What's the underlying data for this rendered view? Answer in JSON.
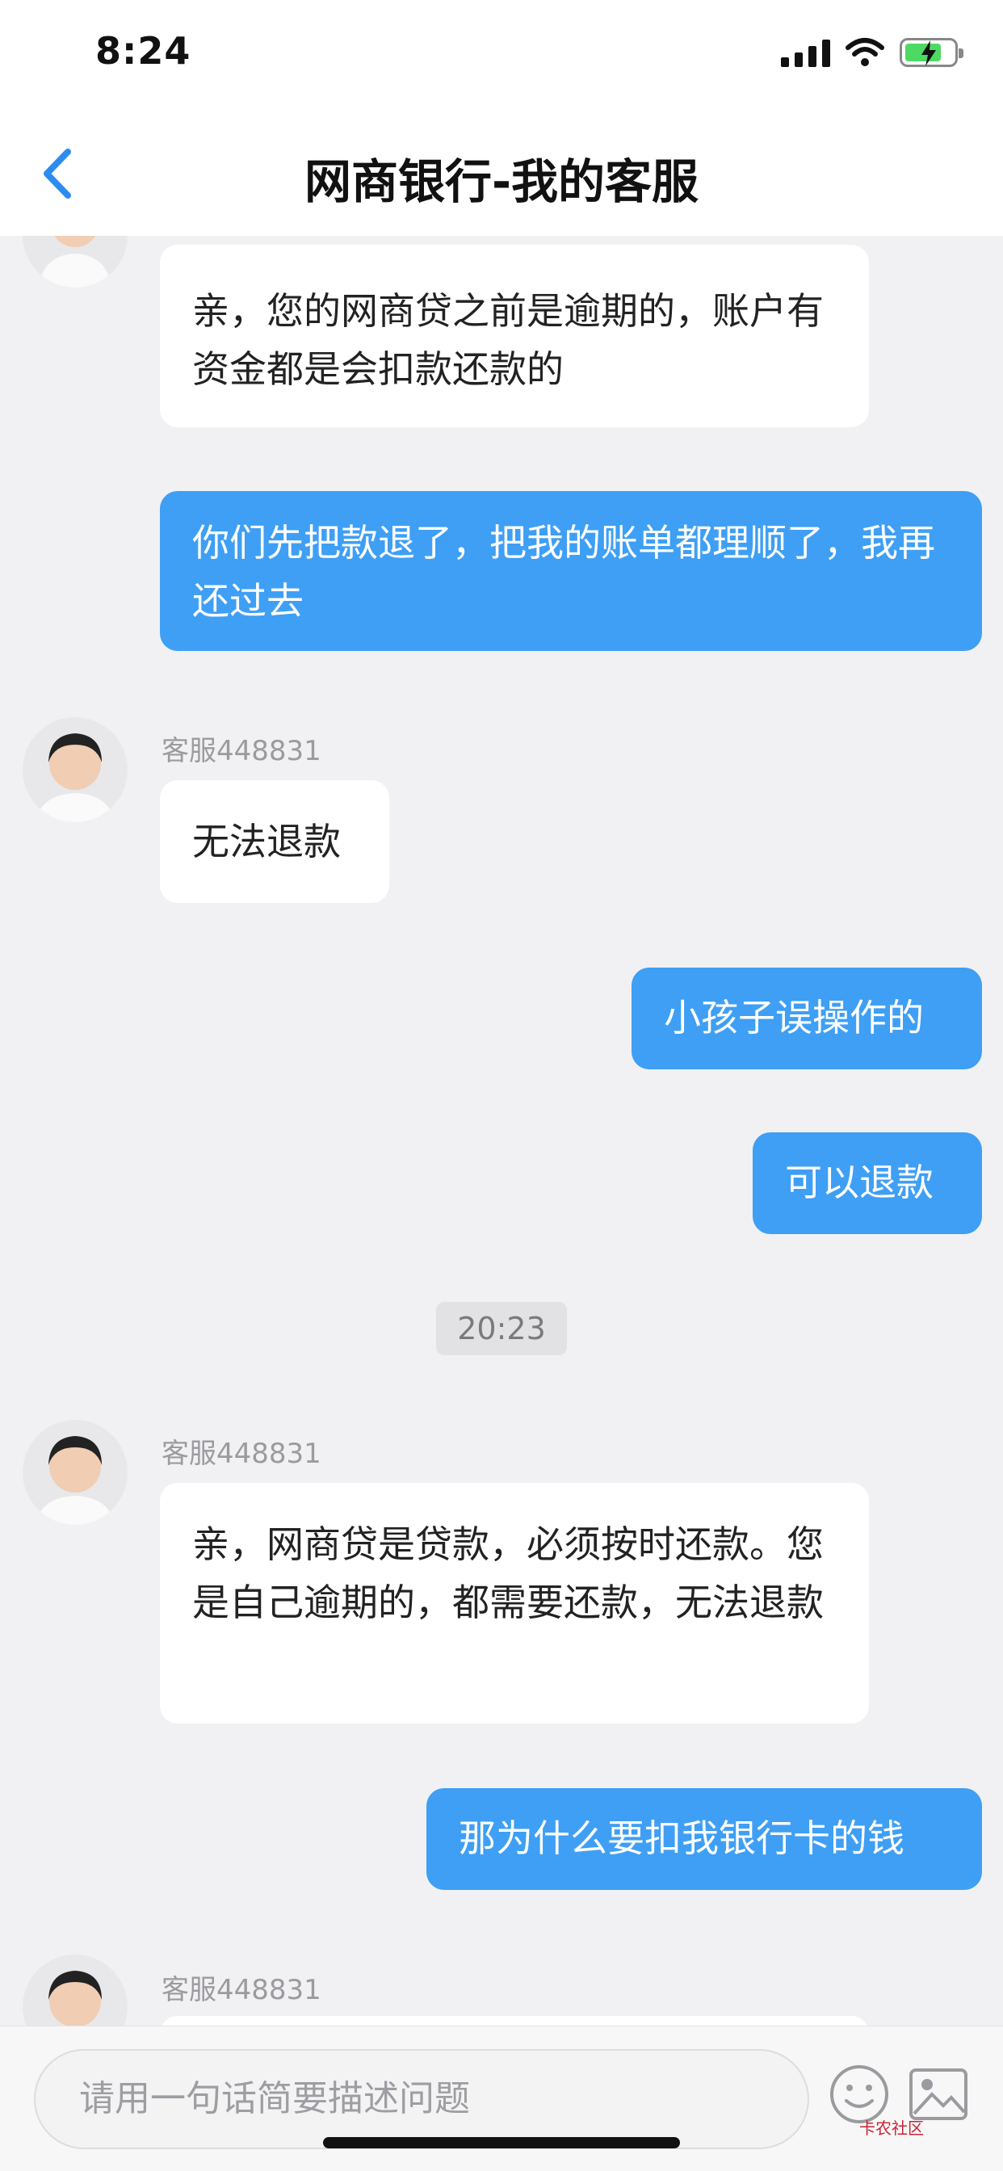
{
  "status_bar": {
    "time": "8:24"
  },
  "nav": {
    "title": "网商银行-我的客服",
    "back_icon": "chevron-left-icon"
  },
  "messages": {
    "m1": {
      "text": "亲，您的网商贷之前是逾期的，账户有资金都是会扣款还款的"
    },
    "m2": {
      "text": "你们先把款退了，把我的账单都理顺了，我再还过去"
    },
    "m3": {
      "sender": "客服448831",
      "text": "无法退款"
    },
    "m4": {
      "text": "小孩子误操作的"
    },
    "m5": {
      "text": "可以退款"
    },
    "time_divider": "20:23",
    "m6": {
      "sender": "客服448831",
      "text": "亲，网商贷是贷款，必须按时还款。您是自己逾期的，都需要还款，无法退款"
    },
    "m7": {
      "text": "那为什么要扣我银行卡的钱"
    },
    "m8": {
      "sender": "客服448831"
    }
  },
  "input": {
    "placeholder": "请用一句话简要描述问题"
  },
  "watermark": "卡农社区",
  "colors": {
    "outgoing_bubble": "#3e9ff5",
    "incoming_bubble": "#ffffff",
    "background": "#f1f1f3",
    "accent": "#2d8cf0"
  }
}
